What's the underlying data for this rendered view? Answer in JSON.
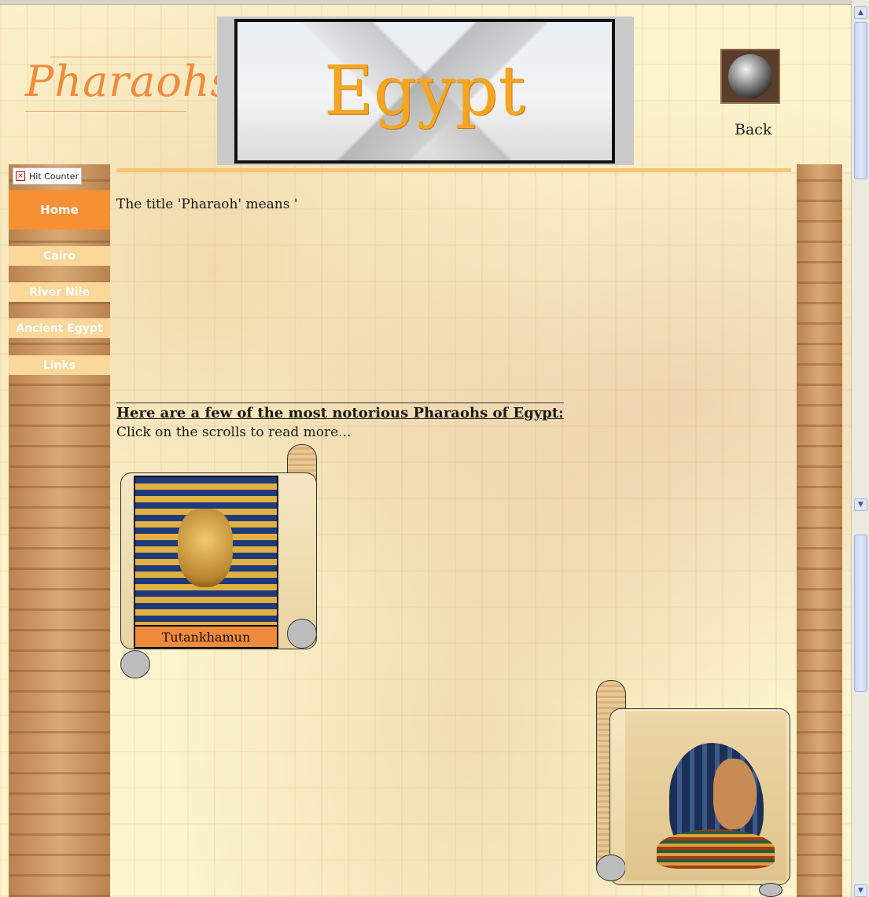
{
  "header": {
    "logo_text": "Pharaohs",
    "banner_title": "Egypt",
    "back_label": "Back"
  },
  "counter": {
    "label": "Hit Counter"
  },
  "nav": {
    "items": [
      "Home",
      "Cairo",
      "River Nile",
      "Ancient Egypt",
      "Links"
    ]
  },
  "main": {
    "intro": "The title 'Pharaoh' means '",
    "heading": "Here are a few of the most notorious Pharaohs of Egypt:",
    "subtext": "Click on the scrolls to read more...",
    "scrolls": [
      {
        "label": "Tutankhamun"
      },
      {
        "label": ""
      }
    ]
  },
  "colors": {
    "accent": "#f78f35",
    "nav_item": "#fbd79a",
    "banner_text": "#f4a622",
    "rule": "#f8c472"
  },
  "icons": {
    "back": "back-orb-icon",
    "counter": "broken-image-icon"
  }
}
